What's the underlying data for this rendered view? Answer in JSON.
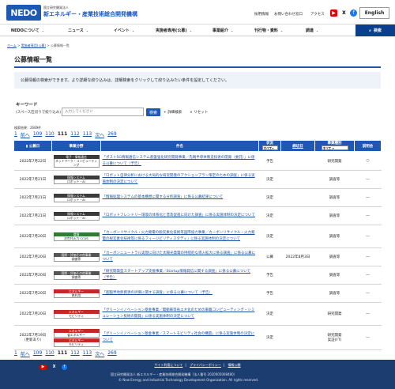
{
  "header": {
    "logo": "NEDO",
    "org_sub": "国立研究開発法人",
    "org_name": "新エネルギー・産業技術総合開発機構",
    "links": [
      "採用情報",
      "お問い合わせ窓口",
      "アクセス"
    ],
    "language_button": "English",
    "social_icons": [
      "youtube-icon",
      "x-icon",
      "facebook-icon"
    ]
  },
  "nav": {
    "items": [
      "NEDOについて",
      "ニュース",
      "イベント",
      "実施者専用(公募)",
      "事業紹介",
      "刊行物・資料",
      "調達"
    ],
    "search_label": "検索"
  },
  "breadcrumb": [
    "ホーム",
    "実施者専用(公募)",
    "公募情報一覧"
  ],
  "page": {
    "title": "公募情報一覧",
    "intro": "公募情報の検索ができます。より詳細な絞り込みは、詳細検索をクリックして絞り込みたい条件を設定してください。"
  },
  "search": {
    "keyword_label": "キーワード",
    "keyword_sub": "(スペース区切りで絞り込み)",
    "placeholder": "入力してください",
    "button": "検索",
    "detail": "+ 詳細検索",
    "reset": "× リセット"
  },
  "results": {
    "count_text": "検索結果：2689件"
  },
  "pager": {
    "items": [
      "1",
      "前へ",
      "109",
      "110",
      "111",
      "112",
      "113",
      "次へ",
      "269"
    ],
    "current": "111"
  },
  "table": {
    "headers": {
      "date": "公募日",
      "category": "事業分野",
      "title": "件名",
      "status": "状況",
      "status_select": "すべて",
      "deadline": "締切日",
      "type": "事業種別",
      "type_select": "すべて",
      "briefing": "説明会"
    },
    "rows": [
      {
        "date": "2022年7月22日",
        "cat_top": "電子・情報通信",
        "cat_top_color": "#3a3a3a",
        "cat_bot": "ネットワーク・コンピューティング",
        "title": "「ポスト5G情報通信システム基盤強化研究開発事業／先端半導体製造技術の開発（委託）」に係る公募について（予告）",
        "status": "予告",
        "deadline": "",
        "type": "研究開発",
        "briefing": "○"
      },
      {
        "date": "2022年7月21日",
        "cat_top": "情報システム",
        "cat_top_color": "#3a3a3a",
        "cat_bot": "ロボット・AI",
        "title": "「ロボット自律分析における大局的な研究開発のアクションプラン策定のための調査」に係る実施体制の決定について",
        "status": "決定",
        "deadline": "",
        "type": "調査等",
        "briefing": "―"
      },
      {
        "date": "2022年7月21日",
        "cat_top": "情報システム",
        "cat_top_color": "#3a3a3a",
        "cat_bot": "ロボット・AI",
        "title": "「情報処理システムの基本構想に関する分析調査」に係る公募結果について",
        "status": "決定",
        "deadline": "",
        "type": "調査等",
        "briefing": "―"
      },
      {
        "date": "2022年7月21日",
        "cat_top": "情報システム",
        "cat_top_color": "#3a3a3a",
        "cat_bot": "ロボット・AI",
        "title": "「ロボットフレンドリー環境の体系化と普及促進に向けた調査」に係る実施体制の決定について",
        "status": "決定",
        "deadline": "",
        "type": "調査等",
        "briefing": "―"
      },
      {
        "date": "2022年7月20日",
        "cat_top": "環境",
        "cat_top_color": "#2e7d32",
        "cat_bot": "次世代火力 CCUS",
        "title": "「カーボンリサイクル・火力発電の脱炭素化技術等国際協力事業／カーボンリサイクル・火力発電の脱炭素化技術等に係るフィージビリティスタディ」に係る実施体制の決定について",
        "status": "決定",
        "deadline": "",
        "type": "調査等",
        "briefing": "―"
      },
      {
        "date": "2022年7月20日",
        "cat_top": "国際・評価その他事業",
        "cat_top_color": "#555555",
        "cat_bot": "調査等",
        "title": "「カーボンニュートラル実現に向けた太陽光発電の持続的な導入拡大に係る調査」に係る公募について",
        "status": "公募",
        "deadline": "2022年8月3日",
        "type": "調査等",
        "briefing": "―"
      },
      {
        "date": "2022年7月20日",
        "cat_top": "国際・評価その他事業",
        "cat_top_color": "#555555",
        "cat_bot": "調査等",
        "title": "「研究開発型スタートアップ支援事業／Startup情報発信に関する調査」に係る公募について（予告）",
        "status": "予告",
        "deadline": "",
        "type": "調査等",
        "briefing": "―"
      },
      {
        "date": "2022年7月20日",
        "cat_top": "エネルギー",
        "cat_top_color": "#c62828",
        "cat_bot": "熱利用",
        "title": "「超臨界地熱資源の評価に関する調査」に係る公募について（予告）",
        "status": "予告",
        "deadline": "",
        "type": "調査等",
        "briefing": "―"
      },
      {
        "date": "2022年7月20日",
        "cat_top": "エネルギー",
        "cat_top_color": "#c62828",
        "cat_bot": "モビリティ",
        "title": "「グリーンイノベーション基金事業／電動車等省エネ化のための車載コンピューティング・シミュレーション技術の開発」に係る実施体制の決定について",
        "status": "決定",
        "deadline": "",
        "type": "研究開発",
        "briefing": "―"
      },
      {
        "date": "2022年7月19日",
        "date2": "（更新あり）",
        "cat_top": "エネルギー",
        "cat_top_color": "#c62828",
        "cat_bot": "省エネルギー",
        "cat_top2": "エネルギー",
        "cat_bot2": "モビリティ",
        "title": "「グリーンイノベーション基金事業／スマートモビリティ社会の構築」に係る実施体制の決定について",
        "status": "決定",
        "deadline": "",
        "type": "研究開発",
        "type2": "実証(FT)",
        "briefing": "―"
      }
    ]
  },
  "footer": {
    "links": [
      "サイト利用について",
      "プライバシーポリシー",
      "情報公開"
    ],
    "address": "国立研究開発法人 新エネルギー・産業技術総合開発機構（法人番号 2020005008480）",
    "copyright": "© New Energy and Industrial Technology Development Organization. All rights reserved.",
    "social_icons": [
      "youtube-icon",
      "x-icon",
      "facebook-icon"
    ]
  }
}
